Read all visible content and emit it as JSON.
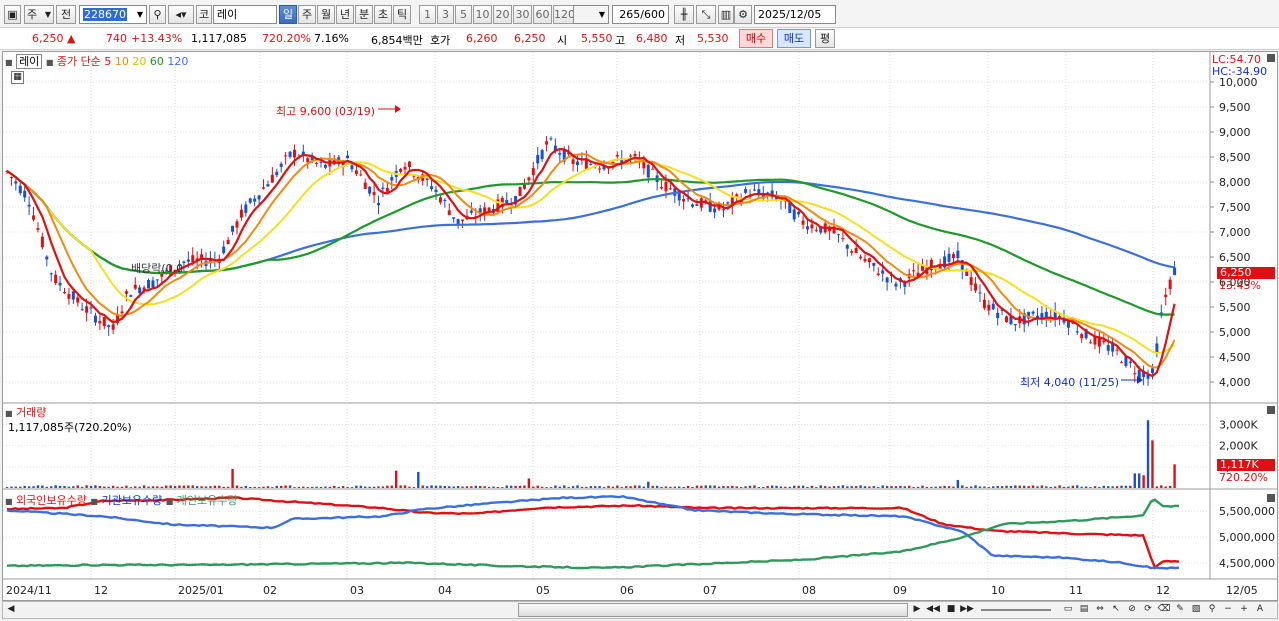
{
  "toolbar": {
    "period_select": "주",
    "prev_label": "전",
    "stock_code": "228670",
    "stock_name": "레이",
    "market_prefix": "코",
    "periods": [
      "일",
      "주",
      "월",
      "년",
      "분",
      "초",
      "틱"
    ],
    "active_period": "일",
    "intervals": [
      "1",
      "3",
      "5",
      "10",
      "20",
      "30",
      "60",
      "120"
    ],
    "count": "265",
    "total": "/600",
    "date": "2025/12/05"
  },
  "quote": {
    "price": "6,250",
    "arrow": "▲",
    "change": "740",
    "change_pct": "+13.43%",
    "volume": "1,117,085",
    "volume_ratio": "720.20%",
    "turnover": "7.16%",
    "amount": "6,854백만",
    "hoga_label": "호가",
    "hoga_ask": "6,260",
    "hoga_bid": "6,250",
    "open_label": "시",
    "open": "5,550",
    "high_label": "고",
    "high": "6,480",
    "low_label": "저",
    "low": "5,530",
    "buy_label": "매수",
    "sell_label": "매도",
    "eval_label": "평"
  },
  "price_panel": {
    "title_box": "레이",
    "legend_prefix": "종가 단순",
    "ma_periods": [
      "5",
      "10",
      "20",
      "60",
      "120"
    ],
    "lc": "LC:54.70",
    "hc": "HC:-34.90",
    "y_ticks": [
      "10,000",
      "9,500",
      "9,000",
      "8,500",
      "8,000",
      "7,500",
      "7,000",
      "6,500",
      "6,000",
      "5,500",
      "5,000",
      "4,500",
      "4,000"
    ],
    "current_price_tag": "6,250",
    "current_pct_tag": "13.43%",
    "annot_high": "최고 9,600 (03/19)",
    "annot_low": "최저 4,040 (11/25)",
    "annot_dividend": "배당락(0.0"
  },
  "volume_panel": {
    "title": "거래량",
    "value": "1,117,085주(720.20%)",
    "y_ticks": [
      "3,000K",
      "2,000K",
      "1,000K"
    ],
    "tag_value": "1,117K",
    "tag_pct": "720.20%"
  },
  "holding_panel": {
    "legend": [
      "외국인보유수량",
      "기관보유수량",
      "개인보유수량"
    ],
    "y_ticks": [
      "5,500,000",
      "5,000,000",
      "4,500,000"
    ]
  },
  "x_axis": [
    "2024/11",
    "12",
    "2025/01",
    "02",
    "03",
    "04",
    "05",
    "06",
    "07",
    "08",
    "09",
    "10",
    "11",
    "12"
  ],
  "x_axis_end": "12/05",
  "colors": {
    "up": "#e01010",
    "down": "#1a4fd0",
    "ma5": "#e01010",
    "ma10": "#f08a10",
    "ma20": "#f5e020",
    "ma60": "#1e9a2a",
    "ma120": "#3b6fe0",
    "foreign": "#e01010",
    "institution": "#3b6fe0",
    "individual": "#2e9a5a"
  }
}
